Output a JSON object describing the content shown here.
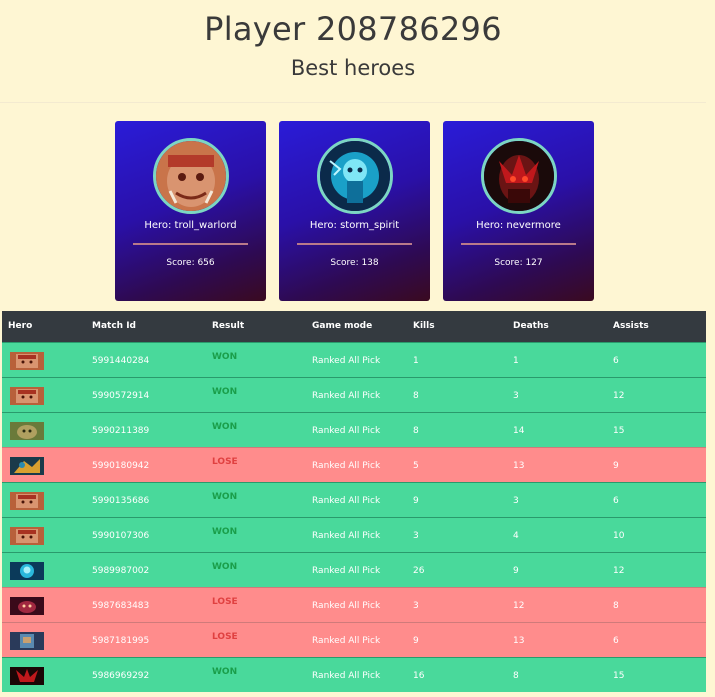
{
  "header": {
    "title": "Player 208786296",
    "subtitle": "Best heroes"
  },
  "best_heroes": [
    {
      "label": "Hero: troll_warlord",
      "score": "Score: 656",
      "icon": "troll-warlord-portrait-icon"
    },
    {
      "label": "Hero: storm_spirit",
      "score": "Score: 138",
      "icon": "storm-spirit-portrait-icon"
    },
    {
      "label": "Hero: nevermore",
      "score": "Score: 127",
      "icon": "nevermore-portrait-icon"
    }
  ],
  "table": {
    "columns": [
      "Hero",
      "Match Id",
      "Result",
      "Game mode",
      "Kills",
      "Deaths",
      "Assists"
    ],
    "rows": [
      {
        "hero": "troll_warlord",
        "match_id": "5991440284",
        "result": "WON",
        "mode": "Ranked All Pick",
        "kills": "1",
        "deaths": "1",
        "assists": "6"
      },
      {
        "hero": "troll_warlord",
        "match_id": "5990572914",
        "result": "WON",
        "mode": "Ranked All Pick",
        "kills": "8",
        "deaths": "3",
        "assists": "12"
      },
      {
        "hero": "hero-3",
        "match_id": "5990211389",
        "result": "WON",
        "mode": "Ranked All Pick",
        "kills": "8",
        "deaths": "14",
        "assists": "15"
      },
      {
        "hero": "hero-4",
        "match_id": "5990180942",
        "result": "LOSE",
        "mode": "Ranked All Pick",
        "kills": "5",
        "deaths": "13",
        "assists": "9"
      },
      {
        "hero": "troll_warlord",
        "match_id": "5990135686",
        "result": "WON",
        "mode": "Ranked All Pick",
        "kills": "9",
        "deaths": "3",
        "assists": "6"
      },
      {
        "hero": "troll_warlord",
        "match_id": "5990107306",
        "result": "WON",
        "mode": "Ranked All Pick",
        "kills": "3",
        "deaths": "4",
        "assists": "10"
      },
      {
        "hero": "storm_spirit",
        "match_id": "5989987002",
        "result": "WON",
        "mode": "Ranked All Pick",
        "kills": "26",
        "deaths": "9",
        "assists": "12"
      },
      {
        "hero": "hero-8",
        "match_id": "5987683483",
        "result": "LOSE",
        "mode": "Ranked All Pick",
        "kills": "3",
        "deaths": "12",
        "assists": "8"
      },
      {
        "hero": "hero-9",
        "match_id": "5987181995",
        "result": "LOSE",
        "mode": "Ranked All Pick",
        "kills": "9",
        "deaths": "13",
        "assists": "6"
      },
      {
        "hero": "nevermore",
        "match_id": "5986969292",
        "result": "WON",
        "mode": "Ranked All Pick",
        "kills": "16",
        "deaths": "8",
        "assists": "15"
      }
    ]
  },
  "colors": {
    "background": "#fef6d3",
    "win_row": "#49d99b",
    "lose_row": "#ff8c8c",
    "win_text": "#1a9e4a",
    "lose_text": "#e04040",
    "table_header": "#343a40",
    "card_accent": "#7cd6c3"
  }
}
